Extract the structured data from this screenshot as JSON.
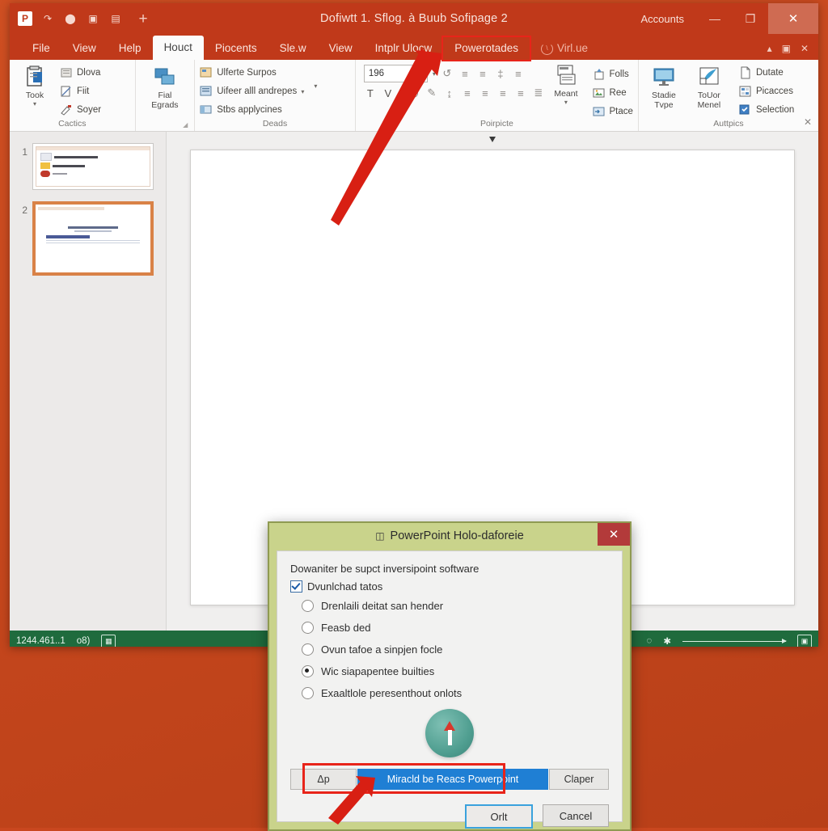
{
  "window": {
    "title": "Dofiwtt 1. Sflog. à Buub Sofipage 2",
    "account_label": "Accounts",
    "quick_access": [
      {
        "name": "app-icon",
        "glyph": "P"
      },
      {
        "name": "autosave-icon",
        "glyph": "↷"
      },
      {
        "name": "save-icon",
        "glyph": "⬤"
      },
      {
        "name": "lock-icon",
        "glyph": "▣"
      },
      {
        "name": "undo-icon",
        "glyph": "▤"
      },
      {
        "name": "new-tab-icon",
        "glyph": "+"
      }
    ],
    "controls": {
      "minimize": "—",
      "restore": "❐",
      "close": "✕"
    }
  },
  "tabs": [
    {
      "label": "File",
      "state": "normal"
    },
    {
      "label": "View",
      "state": "normal"
    },
    {
      "label": "Help",
      "state": "normal"
    },
    {
      "label": "Houct",
      "state": "active"
    },
    {
      "label": "Piocents",
      "state": "normal"
    },
    {
      "label": "Sle.w",
      "state": "normal"
    },
    {
      "label": "View",
      "state": "normal"
    },
    {
      "label": "Intplr Ulocw",
      "state": "normal"
    },
    {
      "label": "Powerotades",
      "state": "highlighted"
    }
  ],
  "tell_me": {
    "label": "Virl.ue",
    "icon": "lightbulb-icon"
  },
  "tabstrip_right": {
    "collapse": "▴",
    "present": "▣",
    "close": "✕"
  },
  "ribbon": {
    "groups": [
      {
        "label": "Cactics",
        "has_dialog_launcher": false,
        "big_buttons": [
          {
            "label": "Took",
            "icon": "paste-icon",
            "dropdown": true
          }
        ],
        "small_buttons": [
          {
            "label": "Dlova",
            "icon": "cut-icon"
          },
          {
            "label": "Fiit",
            "icon": "copy-icon"
          },
          {
            "label": "Soyer",
            "icon": "format-painter-icon"
          }
        ]
      },
      {
        "label": "",
        "has_dialog_launcher": true,
        "big_buttons": [
          {
            "label": "Fial Egrads",
            "icon": "new-slide-icon",
            "dropdown": false
          }
        ],
        "small_buttons": []
      },
      {
        "label": "Deads",
        "has_dialog_launcher": true,
        "big_buttons": [],
        "small_buttons": [
          {
            "label": "Ulferte Surpos",
            "icon": "layout-icon"
          },
          {
            "label": "Uifeer alll andrepes",
            "icon": "reset-icon",
            "dropdown": true
          },
          {
            "label": "Stbs applycines",
            "icon": "section-icon"
          }
        ]
      },
      {
        "label": "Poirpicte",
        "has_dialog_launcher": true,
        "font_size_value": "196",
        "toolbar_row1": [
          "↺",
          "≡",
          "≡",
          "‡",
          "≡"
        ],
        "toolbar_row2": [
          "T",
          "V",
          "◎",
          "✎",
          "⤨",
          "≡",
          "≡",
          "≡",
          "≡",
          "≣"
        ],
        "big_buttons": [
          {
            "label": "Meant",
            "icon": "arrange-icon",
            "dropdown": true
          }
        ],
        "small_buttons": [
          {
            "label": "Folls",
            "icon": "shapes-icon"
          },
          {
            "label": "Ree",
            "icon": "image-icon"
          },
          {
            "label": "Ptace",
            "icon": "replace-icon"
          }
        ]
      },
      {
        "label": "Auttpics",
        "has_dialog_launcher": true,
        "big_buttons": [
          {
            "label": "Stadie Tvpe",
            "icon": "screen-icon",
            "dropdown": false
          },
          {
            "label": "ToUor Menel",
            "icon": "design-ideas-icon",
            "dropdown": false
          }
        ],
        "small_buttons": [
          {
            "label": "Dutate",
            "icon": "document-icon"
          },
          {
            "label": "Picacces",
            "icon": "grid-icon"
          },
          {
            "label": "Selection",
            "icon": "selection-pane-icon"
          }
        ]
      }
    ],
    "close_label": "✕"
  },
  "thumbnails": [
    {
      "number": "1",
      "selected": false
    },
    {
      "number": "2",
      "selected": true
    }
  ],
  "status_bar": {
    "left_text": "1244.461..1",
    "secondary_text": "o8)",
    "notes_icon": "notes-icon",
    "accessibility_icon": "accessibility-icon",
    "comments_icon": "comments-icon",
    "views_icon": "view-icon",
    "fit_icon": "fit-slide-icon"
  },
  "dialog": {
    "title": "PowerPoint Holo-daforeie",
    "title_icon": "powerpoint-icon",
    "close": "✕",
    "lead_text": "Dowaniter be supct inversipoint software",
    "checkbox": {
      "label": "Dvunlchad tatos",
      "checked": true
    },
    "radios": [
      {
        "label": "Drenlaili deitat san hender",
        "selected": false
      },
      {
        "label": "Feasb ded",
        "selected": false
      },
      {
        "label": "Ovun tafoe a sinpjen focle",
        "selected": false
      },
      {
        "label": "Wic siapapentee builties",
        "selected": true
      },
      {
        "label": "Exaaltlole peresenthout onlots",
        "selected": false
      }
    ],
    "badge_icon": "upload-arrow-icon",
    "segmented": [
      {
        "label": "Δр",
        "selected": false
      },
      {
        "label": "Miracld be Reacs Powerpoint",
        "selected": true
      },
      {
        "label": "Claper",
        "selected": false
      }
    ],
    "ok_label": "Orlt",
    "cancel_label": "Cancel"
  },
  "annotations": {
    "highlight_color": "#e8241a",
    "arrow_1_target": "Powerotades tab",
    "arrow_2_target": "Miracld be Reacs Powerpoint button"
  }
}
